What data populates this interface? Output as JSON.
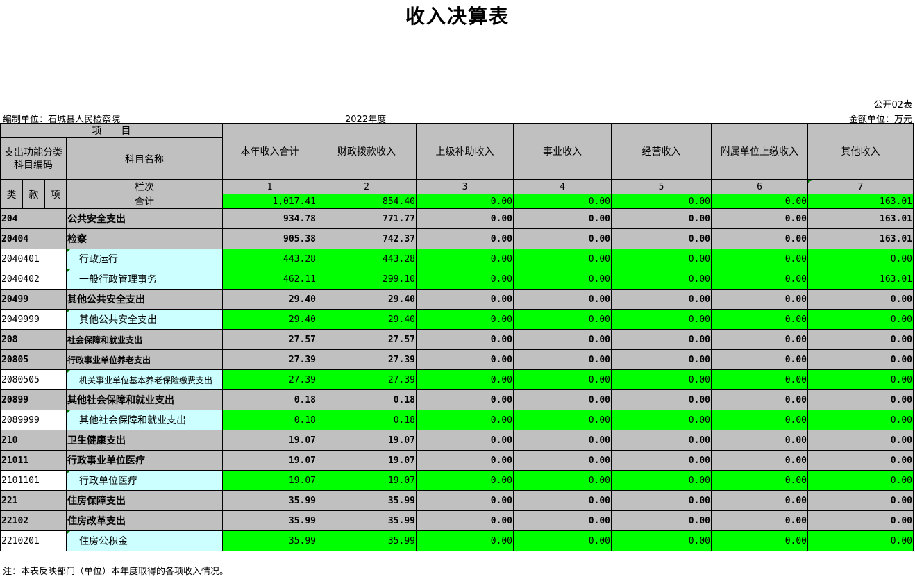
{
  "title": "收入决算表",
  "table_no": "公开02表",
  "unit_label": "编制单位：石城县人民检察院",
  "year": "2022年度",
  "amount_unit": "金额单位：万元",
  "header": {
    "item": "项　　目",
    "code": "支出功能分类科目编码",
    "name": "科目名称",
    "cols": [
      "本年收入合计",
      "财政拨款收入",
      "上级补助收入",
      "事业收入",
      "经营收入",
      "附属单位上缴收入",
      "其他收入"
    ],
    "lei": "类",
    "kuan": "款",
    "xiang": "项",
    "lanci": "栏次",
    "col_nums": [
      "1",
      "2",
      "3",
      "4",
      "5",
      "6",
      "7"
    ]
  },
  "total": {
    "label": "合计",
    "values": [
      "1,017.41",
      "854.40",
      "0.00",
      "0.00",
      "0.00",
      "0.00",
      "163.01"
    ]
  },
  "rows": [
    {
      "code": "204",
      "name": "公共安全支出",
      "level": "group",
      "values": [
        "934.78",
        "771.77",
        "0.00",
        "0.00",
        "0.00",
        "0.00",
        "163.01"
      ]
    },
    {
      "code": "20404",
      "name": "检察",
      "level": "group",
      "values": [
        "905.38",
        "742.37",
        "0.00",
        "0.00",
        "0.00",
        "0.00",
        "163.01"
      ]
    },
    {
      "code": "2040401",
      "name": "行政运行",
      "level": "item",
      "values": [
        "443.28",
        "443.28",
        "0.00",
        "0.00",
        "0.00",
        "0.00",
        "0.00"
      ]
    },
    {
      "code": "2040402",
      "name": "一般行政管理事务",
      "level": "item",
      "values": [
        "462.11",
        "299.10",
        "0.00",
        "0.00",
        "0.00",
        "0.00",
        "163.01"
      ]
    },
    {
      "code": "20499",
      "name": "其他公共安全支出",
      "level": "group",
      "values": [
        "29.40",
        "29.40",
        "0.00",
        "0.00",
        "0.00",
        "0.00",
        "0.00"
      ]
    },
    {
      "code": "2049999",
      "name": "其他公共安全支出",
      "level": "item",
      "values": [
        "29.40",
        "29.40",
        "0.00",
        "0.00",
        "0.00",
        "0.00",
        "0.00"
      ]
    },
    {
      "code": "208",
      "name": "社会保障和就业支出",
      "level": "group-small",
      "values": [
        "27.57",
        "27.57",
        "0.00",
        "0.00",
        "0.00",
        "0.00",
        "0.00"
      ]
    },
    {
      "code": "20805",
      "name": "行政事业单位养老支出",
      "level": "group-small",
      "values": [
        "27.39",
        "27.39",
        "0.00",
        "0.00",
        "0.00",
        "0.00",
        "0.00"
      ]
    },
    {
      "code": "2080505",
      "name": "机关事业单位基本养老保险缴费支出",
      "level": "item-small",
      "values": [
        "27.39",
        "27.39",
        "0.00",
        "0.00",
        "0.00",
        "0.00",
        "0.00"
      ]
    },
    {
      "code": "20899",
      "name": "其他社会保障和就业支出",
      "level": "group",
      "values": [
        "0.18",
        "0.18",
        "0.00",
        "0.00",
        "0.00",
        "0.00",
        "0.00"
      ]
    },
    {
      "code": "2089999",
      "name": "其他社会保障和就业支出",
      "level": "item",
      "values": [
        "0.18",
        "0.18",
        "0.00",
        "0.00",
        "0.00",
        "0.00",
        "0.00"
      ]
    },
    {
      "code": "210",
      "name": "卫生健康支出",
      "level": "group",
      "values": [
        "19.07",
        "19.07",
        "0.00",
        "0.00",
        "0.00",
        "0.00",
        "0.00"
      ]
    },
    {
      "code": "21011",
      "name": "行政事业单位医疗",
      "level": "group",
      "values": [
        "19.07",
        "19.07",
        "0.00",
        "0.00",
        "0.00",
        "0.00",
        "0.00"
      ]
    },
    {
      "code": "2101101",
      "name": "行政单位医疗",
      "level": "item",
      "values": [
        "19.07",
        "19.07",
        "0.00",
        "0.00",
        "0.00",
        "0.00",
        "0.00"
      ]
    },
    {
      "code": "221",
      "name": "住房保障支出",
      "level": "group",
      "values": [
        "35.99",
        "35.99",
        "0.00",
        "0.00",
        "0.00",
        "0.00",
        "0.00"
      ]
    },
    {
      "code": "22102",
      "name": "住房改革支出",
      "level": "group",
      "values": [
        "35.99",
        "35.99",
        "0.00",
        "0.00",
        "0.00",
        "0.00",
        "0.00"
      ]
    },
    {
      "code": "2210201",
      "name": "住房公积金",
      "level": "item",
      "values": [
        "35.99",
        "35.99",
        "0.00",
        "0.00",
        "0.00",
        "0.00",
        "0.00"
      ]
    }
  ],
  "note": "注：本表反映部门（单位）本年度取得的各项收入情况。"
}
